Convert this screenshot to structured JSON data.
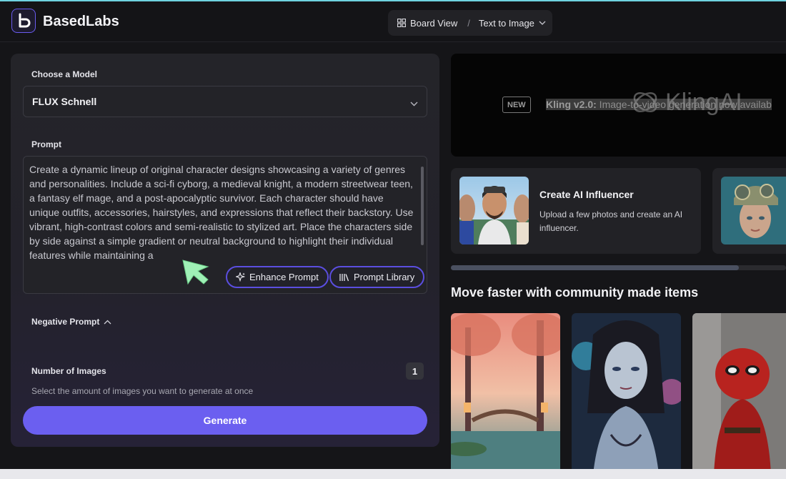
{
  "header": {
    "brand": "BasedLabs",
    "breadcrumb": {
      "view": "Board View",
      "separator": "/",
      "page": "Text to Image"
    }
  },
  "form": {
    "model_label": "Choose a Model",
    "model_value": "FLUX Schnell",
    "prompt_label": "Prompt",
    "prompt_value": "Create a dynamic lineup of original character designs showcasing a variety of genres and personalities. Include a sci-fi cyborg, a medieval knight, a modern streetwear teen, a fantasy elf mage, and a post-apocalyptic survivor. Each character should have unique outfits, accessories, hairstyles, and expressions that reflect their backstory. Use vibrant, high-contrast colors and semi-realistic to stylized art. Place the characters side by side against a simple gradient or neutral background to highlight their individual features while maintaining a",
    "enhance_label": "Enhance Prompt",
    "library_label": "Prompt Library",
    "negative_label": "Negative Prompt",
    "num_images_label": "Number of Images",
    "num_images_value": "1",
    "num_images_hint": "Select the amount of images you want to generate at once",
    "generate_label": "Generate"
  },
  "banner": {
    "badge": "NEW",
    "headline": "Kling v2.0:",
    "text": " Image-to-video generation now availab",
    "logo_text": "KlingAI"
  },
  "cards": [
    {
      "title": "Create AI Influencer",
      "desc": "Upload a few photos and create an AI influencer."
    }
  ],
  "community": {
    "title": "Move faster with community made items"
  },
  "colors": {
    "accent": "#6b5ff0",
    "background": "#151518",
    "panel": "#242429"
  }
}
